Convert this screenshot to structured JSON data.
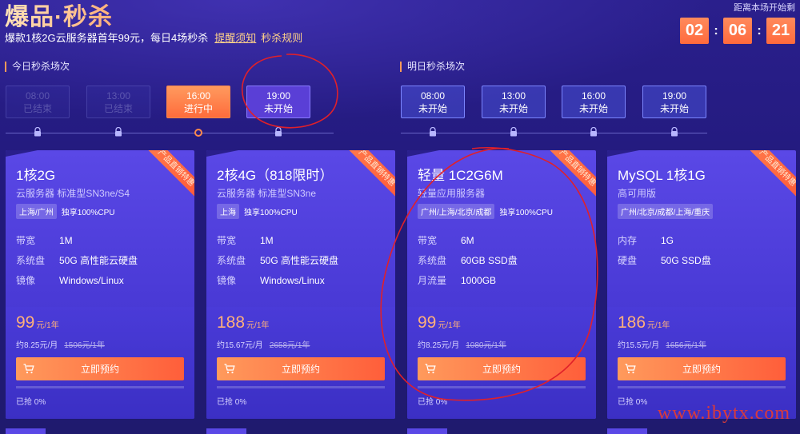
{
  "header": {
    "title": "爆品·秒杀",
    "subtitle": "爆款1核2G云服务器首年99元，每日4场秒杀",
    "remind_link": "提醒须知",
    "rules_link": "秒杀规则",
    "countdown_label": "距离本场开始剩",
    "countdown": {
      "h": "02",
      "m": "06",
      "s": "21"
    },
    "sep": ":"
  },
  "today": {
    "label": "今日秒杀场次",
    "sessions": [
      {
        "time": "08:00",
        "status": "已结束"
      },
      {
        "time": "13:00",
        "status": "已结束"
      },
      {
        "time": "16:00",
        "status": "进行中"
      },
      {
        "time": "19:00",
        "status": "未开始"
      }
    ]
  },
  "tomorrow": {
    "label": "明日秒杀场次",
    "sessions": [
      {
        "time": "08:00",
        "status": "未开始"
      },
      {
        "time": "13:00",
        "status": "未开始"
      },
      {
        "time": "16:00",
        "status": "未开始"
      },
      {
        "time": "19:00",
        "status": "未开始"
      }
    ]
  },
  "ribbon": "产品直销特惠",
  "buy_label": "立即预约",
  "cards": [
    {
      "name": "1核2G",
      "desc": "云服务器 标准型SN3ne/S4",
      "region": "上海/广州",
      "cpu": "独享100%CPU",
      "specs": [
        {
          "k": "带宽",
          "v": "1M"
        },
        {
          "k": "系统盘",
          "v": "50G 高性能云硬盘"
        },
        {
          "k": "镜像",
          "v": "Windows/Linux"
        }
      ],
      "price": "99",
      "unit": "元/1年",
      "monthly": "约8.25元/月",
      "orig": "1506元/1年",
      "sold": "已抢 0%",
      "progress": 0
    },
    {
      "name": "2核4G（818限时）",
      "desc": "云服务器 标准型SN3ne",
      "region": "上海",
      "cpu": "独享100%CPU",
      "specs": [
        {
          "k": "带宽",
          "v": "1M"
        },
        {
          "k": "系统盘",
          "v": "50G 高性能云硬盘"
        },
        {
          "k": "镜像",
          "v": "Windows/Linux"
        }
      ],
      "price": "188",
      "unit": "元/1年",
      "monthly": "约15.67元/月",
      "orig": "2658元/1年",
      "sold": "已抢 0%",
      "progress": 0
    },
    {
      "name": "轻量 1C2G6M",
      "desc": "轻量应用服务器",
      "region": "广州/上海/北京/成都",
      "cpu": "独享100%CPU",
      "specs": [
        {
          "k": "带宽",
          "v": "6M"
        },
        {
          "k": "系统盘",
          "v": "60GB SSD盘"
        },
        {
          "k": "月流量",
          "v": "1000GB"
        }
      ],
      "price": "99",
      "unit": "元/1年",
      "monthly": "约8.25元/月",
      "orig": "1080元/1年",
      "sold": "已抢 0%",
      "progress": 0
    },
    {
      "name": "MySQL 1核1G",
      "desc": "高可用版",
      "region": "广州/北京/成都/上海/重庆",
      "cpu": "",
      "specs": [
        {
          "k": "内存",
          "v": "1G"
        },
        {
          "k": "硬盘",
          "v": "50G SSD盘"
        }
      ],
      "price": "186",
      "unit": "元/1年",
      "monthly": "约15.5元/月",
      "orig": "1656元/1年",
      "sold": "已抢 0%",
      "progress": 0
    }
  ],
  "watermark": "www.ibytx.com",
  "colors": {
    "accent": "#ff6c3c",
    "price": "#ffb07a",
    "annotation": "#e0202a"
  }
}
